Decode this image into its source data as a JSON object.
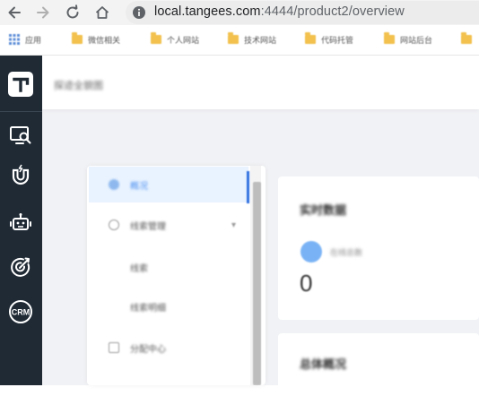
{
  "browser": {
    "url_host": "local.tangees.com",
    "url_rest": ":4444/product2/overview",
    "bookmarks": [
      "应用",
      "微信相关",
      "个人网站",
      "技术网站",
      "代码托管",
      "网站后台",
      "..."
    ]
  },
  "leftbar": {
    "items": [
      "monitor-search",
      "magnet-lightning",
      "robot",
      "target",
      "crm"
    ],
    "crm_label": "CRM"
  },
  "header": {
    "title": "探迹全貌图"
  },
  "menu": {
    "items": [
      {
        "label": "概况",
        "active": true
      },
      {
        "label": "线索管理",
        "expanded": true
      },
      {
        "label": "线索"
      },
      {
        "label": "线索明细"
      },
      {
        "label": "分配中心"
      }
    ]
  },
  "cards": {
    "realtime": {
      "title": "实时数据",
      "stat_label": "在线总数",
      "stat_value": "0"
    },
    "overview": {
      "title": "总体概况"
    }
  },
  "colors": {
    "sidebar": "#1f2a35",
    "accent": "#4a8ef0",
    "active_bg": "#e9f3ff"
  }
}
